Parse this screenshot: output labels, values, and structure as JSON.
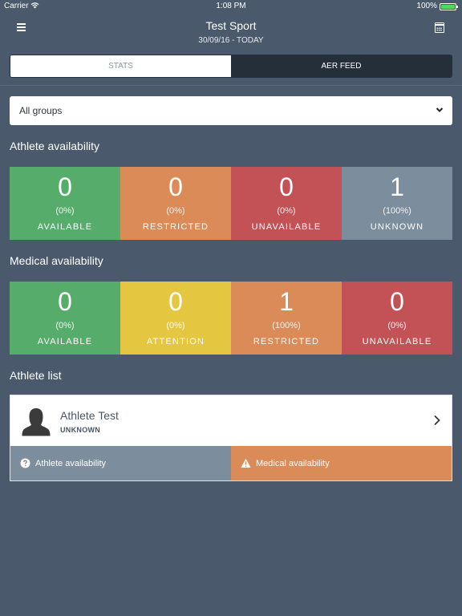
{
  "status_bar": {
    "carrier": "Carrier",
    "time": "1:08 PM",
    "battery": "100%",
    "wifi_icon": "wifi-icon",
    "battery_icon": "battery-icon"
  },
  "header": {
    "title": "Test Sport",
    "subtitle": "30/09/16 - TODAY",
    "menu_icon": "hamburger-menu-icon",
    "calendar_icon": "calendar-icon"
  },
  "tabs": [
    {
      "label": "STATS",
      "active": true
    },
    {
      "label": "AER FEED",
      "active": false
    }
  ],
  "group_select": {
    "value": "All groups",
    "icon": "chevron-down-icon"
  },
  "athlete_availability": {
    "heading": "Athlete availability",
    "tiles": [
      {
        "count": "0",
        "pct": "(0%)",
        "label": "AVAILABLE",
        "color": "#56ad6b"
      },
      {
        "count": "0",
        "pct": "(0%)",
        "label": "RESTRICTED",
        "color": "#da8b57"
      },
      {
        "count": "0",
        "pct": "(0%)",
        "label": "UNAVAILABLE",
        "color": "#c35256"
      },
      {
        "count": "1",
        "pct": "(100%)",
        "label": "UNKNOWN",
        "color": "#7c8d9d"
      }
    ]
  },
  "medical_availability": {
    "heading": "Medical availability",
    "tiles": [
      {
        "count": "0",
        "pct": "(0%)",
        "label": "AVAILABLE",
        "color": "#56ad6b"
      },
      {
        "count": "0",
        "pct": "(0%)",
        "label": "ATTENTION",
        "color": "#e5c640"
      },
      {
        "count": "1",
        "pct": "(100%)",
        "label": "RESTRICTED",
        "color": "#da8b57"
      },
      {
        "count": "0",
        "pct": "(0%)",
        "label": "UNAVAILABLE",
        "color": "#c35256"
      }
    ]
  },
  "athlete_list": {
    "heading": "Athlete list",
    "athletes": [
      {
        "name": "Athlete Test",
        "status": "UNKNOWN",
        "avatar_icon": "person-silhouette-icon",
        "athlete_availability": {
          "label": "Athlete availability",
          "icon": "question-circle-icon",
          "color": "#7c8d9d"
        },
        "medical_availability": {
          "label": "Medical availability",
          "icon": "warning-triangle-icon",
          "color": "#da8b57"
        }
      }
    ]
  }
}
